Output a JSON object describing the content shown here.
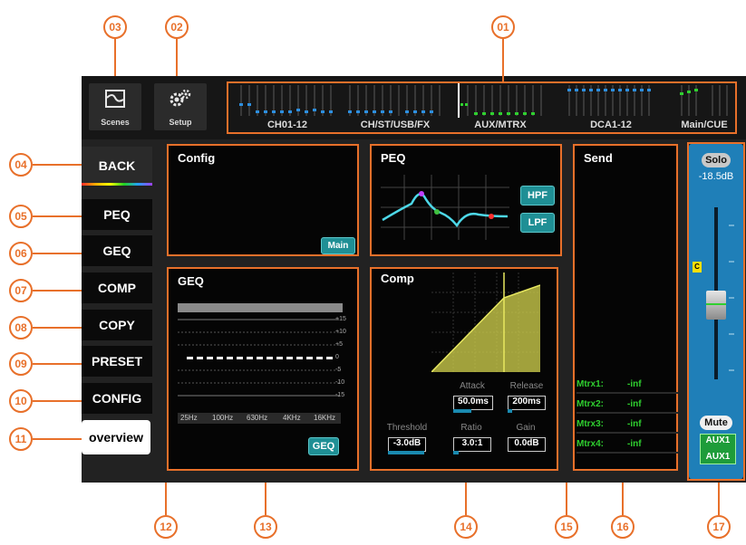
{
  "callouts": [
    "01",
    "02",
    "03",
    "04",
    "05",
    "06",
    "07",
    "08",
    "09",
    "10",
    "11",
    "12",
    "13",
    "14",
    "15",
    "16",
    "17"
  ],
  "top_buttons": {
    "scenes": "Scenes",
    "setup": "Setup"
  },
  "meter_groups": [
    "CH01-12",
    "CH/ST/USB/FX",
    "AUX/MTRX",
    "DCA1-12",
    "Main/CUE"
  ],
  "sidebar": [
    "BACK",
    "PEQ",
    "GEQ",
    "COMP",
    "COPY",
    "PRESET",
    "CONFIG",
    "overview"
  ],
  "config": {
    "title": "Config",
    "main_button": "Main"
  },
  "peq": {
    "title": "PEQ",
    "hpf": "HPF",
    "lpf": "LPF"
  },
  "geq": {
    "title": "GEQ",
    "scale": [
      "+15",
      "+10",
      "+5",
      "0",
      "-5",
      "-10",
      "-15"
    ],
    "freqs": [
      "25Hz",
      "100Hz",
      "630Hz",
      "4KHz",
      "16KHz"
    ],
    "button": "GEQ"
  },
  "comp": {
    "title": "Comp",
    "attack": {
      "label": "Attack",
      "value": "50.0ms"
    },
    "release": {
      "label": "Release",
      "value": "200ms"
    },
    "threshold": {
      "label": "Threshold",
      "value": "-3.0dB"
    },
    "ratio": {
      "label": "Ratio",
      "value": "3.0:1"
    },
    "gain": {
      "label": "Gain",
      "value": "0.0dB"
    }
  },
  "send": {
    "title": "Send",
    "items": [
      {
        "name": "Mtrx1:",
        "value": "-inf"
      },
      {
        "name": "Mtrx2:",
        "value": "-inf"
      },
      {
        "name": "Mtrx3:",
        "value": "-inf"
      },
      {
        "name": "Mtrx4:",
        "value": "-inf"
      }
    ]
  },
  "channel_strip": {
    "solo": "Solo",
    "level": "-18.5dB",
    "c_marker": "C",
    "mute": "Mute",
    "aux_top": "AUX1",
    "aux_bottom": "AUX1"
  },
  "colors": {
    "accent": "#e8702a",
    "teal": "#1f8f95",
    "strip": "#1f7fb8",
    "meter_green": "#2fd02f",
    "meter_blue": "#2d8fe0"
  }
}
